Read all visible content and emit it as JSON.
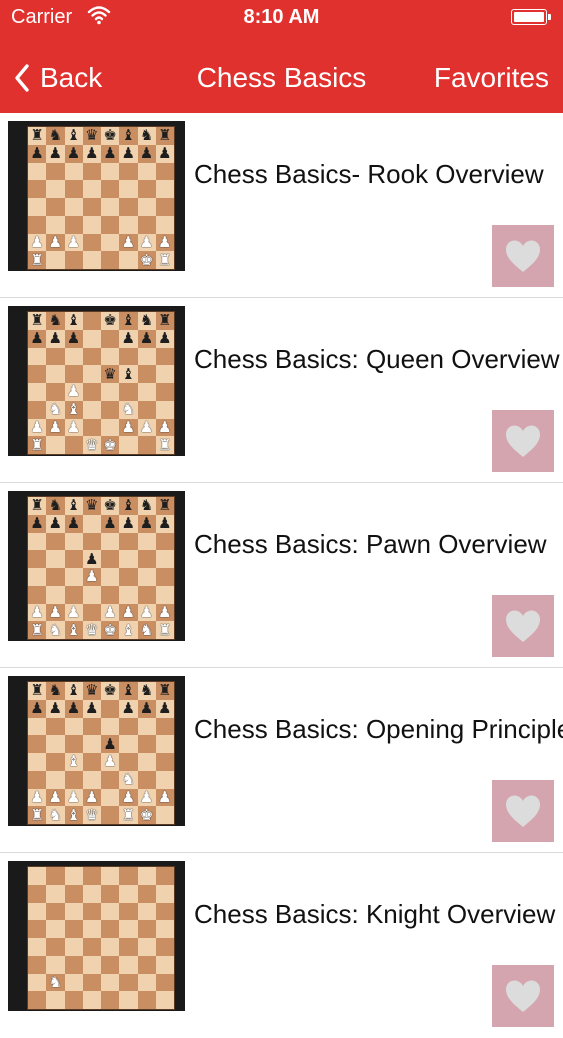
{
  "status_bar": {
    "carrier": "Carrier",
    "time": "8:10 AM",
    "wifi_icon": "wifi-icon",
    "battery_icon": "battery-icon"
  },
  "nav": {
    "back_label": "Back",
    "back_icon": "chevron-left-icon",
    "title": "Chess Basics",
    "favorites_label": "Favorites"
  },
  "colors": {
    "accent": "#e0312e",
    "favorite_tile": "#d4a5ae",
    "heart": "#dcdcdc",
    "board_light": "#f0d2ae",
    "board_dark": "#c98e62"
  },
  "items": [
    {
      "title": "Chess Basics- Rook Overview",
      "favorite_icon": "heart-icon",
      "board": [
        "rnbqkbnr",
        "pppppppp",
        "........",
        "........",
        "........",
        "........",
        "PPP..PPP",
        "R.....KR"
      ]
    },
    {
      "title": "Chess Basics: Queen Overview",
      "favorite_icon": "heart-icon",
      "board": [
        "rnb.kbnr",
        "ppp..ppp",
        "........",
        "....qb..",
        "..P.....",
        ".NB..N..",
        "PPP..PPP",
        "R..QK..R"
      ]
    },
    {
      "title": "Chess Basics: Pawn Overview",
      "favorite_icon": "heart-icon",
      "board": [
        "rnbqkbnr",
        "ppp.pppp",
        "........",
        "...p....",
        "...P....",
        "........",
        "PPP.PPPP",
        "RNBQKBNR"
      ]
    },
    {
      "title": "Chess Basics: Opening Principles",
      "favorite_icon": "heart-icon",
      "board": [
        "rnbqkbnr",
        "pppp.ppp",
        "........",
        "....p...",
        "..B.P...",
        ".....N..",
        "PPPP.PPP",
        "RNBQ.RK."
      ]
    },
    {
      "title": "Chess Basics: Knight Overview",
      "favorite_icon": "heart-icon",
      "board": [
        "........",
        "........",
        "........",
        "........",
        "........",
        "........",
        ".N......",
        "........"
      ]
    }
  ]
}
